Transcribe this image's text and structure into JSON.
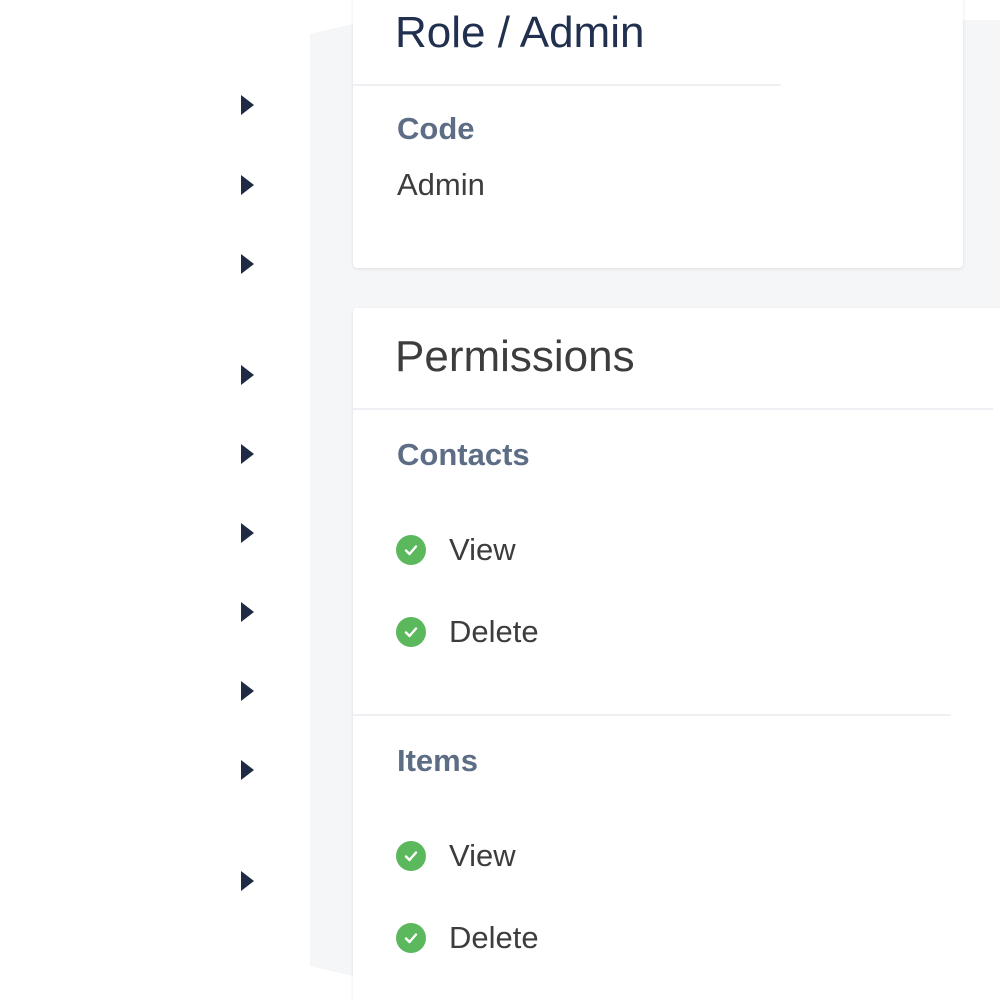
{
  "role_card": {
    "title": "Role / Admin",
    "code_label": "Code",
    "code_value": "Admin"
  },
  "permissions_card": {
    "title": "Permissions",
    "groups": [
      {
        "name": "Contacts",
        "permissions": [
          {
            "label": "View",
            "granted": true
          },
          {
            "label": "Delete",
            "granted": true
          }
        ]
      },
      {
        "name": "Items",
        "permissions": [
          {
            "label": "View",
            "granted": true
          },
          {
            "label": "Delete",
            "granted": true
          }
        ]
      }
    ]
  },
  "sidebar": {
    "arrow_icon": "caret-right-icon",
    "arrow_count": 10
  },
  "colors": {
    "arrow": "#1f2a44",
    "section_label": "#5d6d86",
    "check": "#5cb85c",
    "backdrop": "#f5f6f8"
  }
}
